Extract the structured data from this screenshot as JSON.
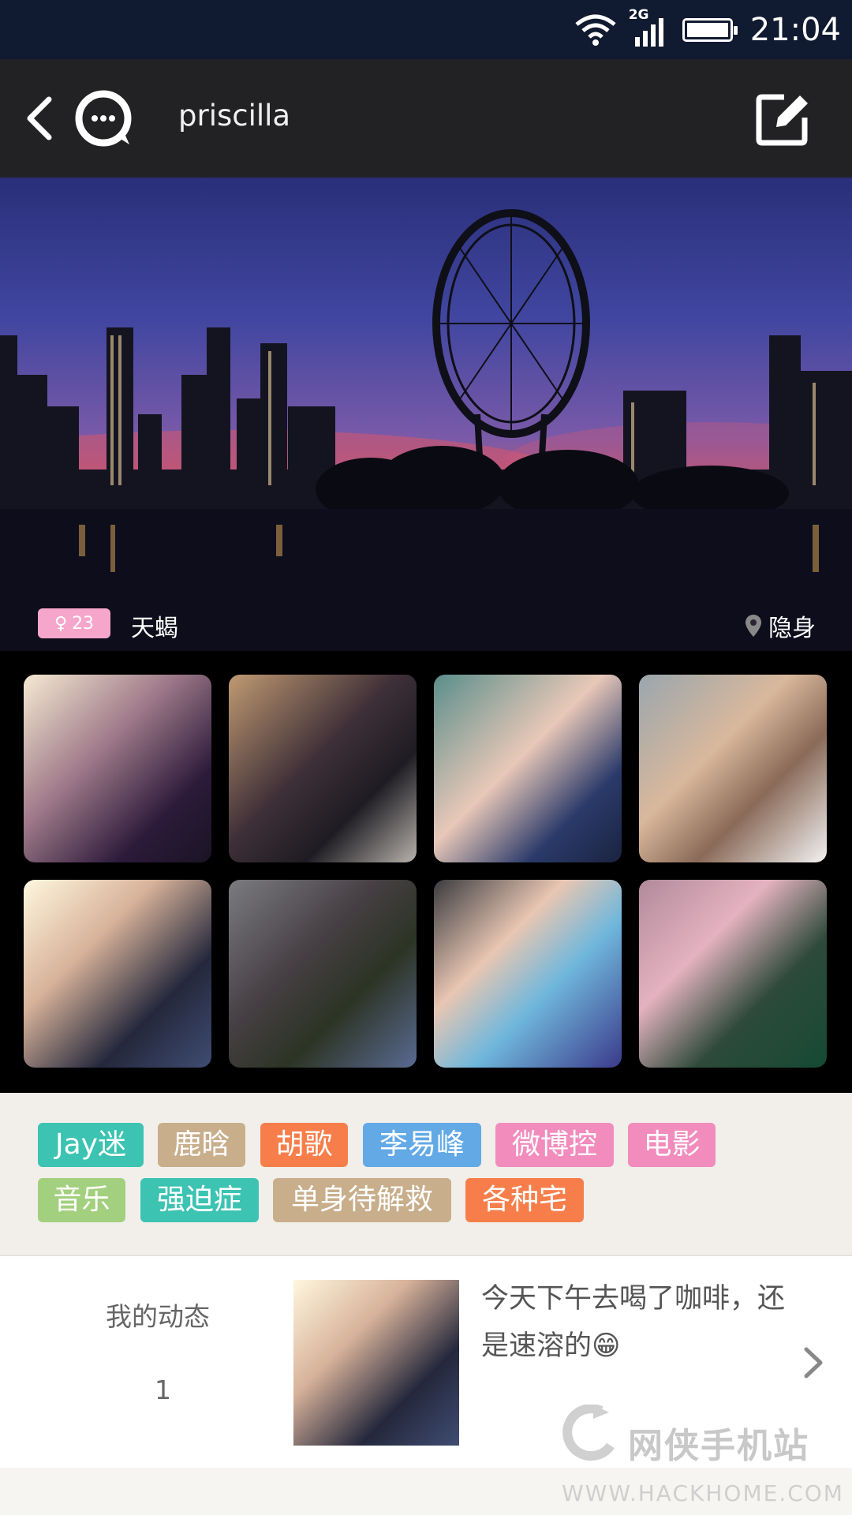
{
  "status_bar": {
    "network": "2G",
    "time": "21:04"
  },
  "header": {
    "title": "priscilla",
    "back_icon": "chevron-left-icon",
    "chat_icon": "chat-bubble-icon",
    "edit_icon": "edit-icon"
  },
  "profile": {
    "age": "23",
    "gender_icon": "female-icon",
    "zodiac": "天蝎",
    "location": "隐身"
  },
  "photos": [
    {
      "name": "photo-1"
    },
    {
      "name": "photo-2"
    },
    {
      "name": "photo-3"
    },
    {
      "name": "photo-4"
    },
    {
      "name": "photo-5"
    },
    {
      "name": "photo-6"
    },
    {
      "name": "photo-7"
    },
    {
      "name": "photo-8"
    }
  ],
  "tags": [
    {
      "label": "Jay迷",
      "color": "#3cc3b2"
    },
    {
      "label": "鹿晗",
      "color": "#c8ae8b"
    },
    {
      "label": "胡歌",
      "color": "#f77e4a"
    },
    {
      "label": "李易峰",
      "color": "#62a9e6"
    },
    {
      "label": "微博控",
      "color": "#f28cbd"
    },
    {
      "label": "电影",
      "color": "#f28cbd"
    },
    {
      "label": "音乐",
      "color": "#a3d07e"
    },
    {
      "label": "强迫症",
      "color": "#3cc3b2"
    },
    {
      "label": "单身待解救",
      "color": "#c8ae8b"
    },
    {
      "label": "各种宅",
      "color": "#f77e4a"
    }
  ],
  "feed": {
    "label": "我的动态",
    "count": "1",
    "text": "今天下午去喝了咖啡，还是速溶的😁"
  },
  "watermark": {
    "name": "网侠手机站",
    "url": "WWW.HACKHOME.COM"
  }
}
